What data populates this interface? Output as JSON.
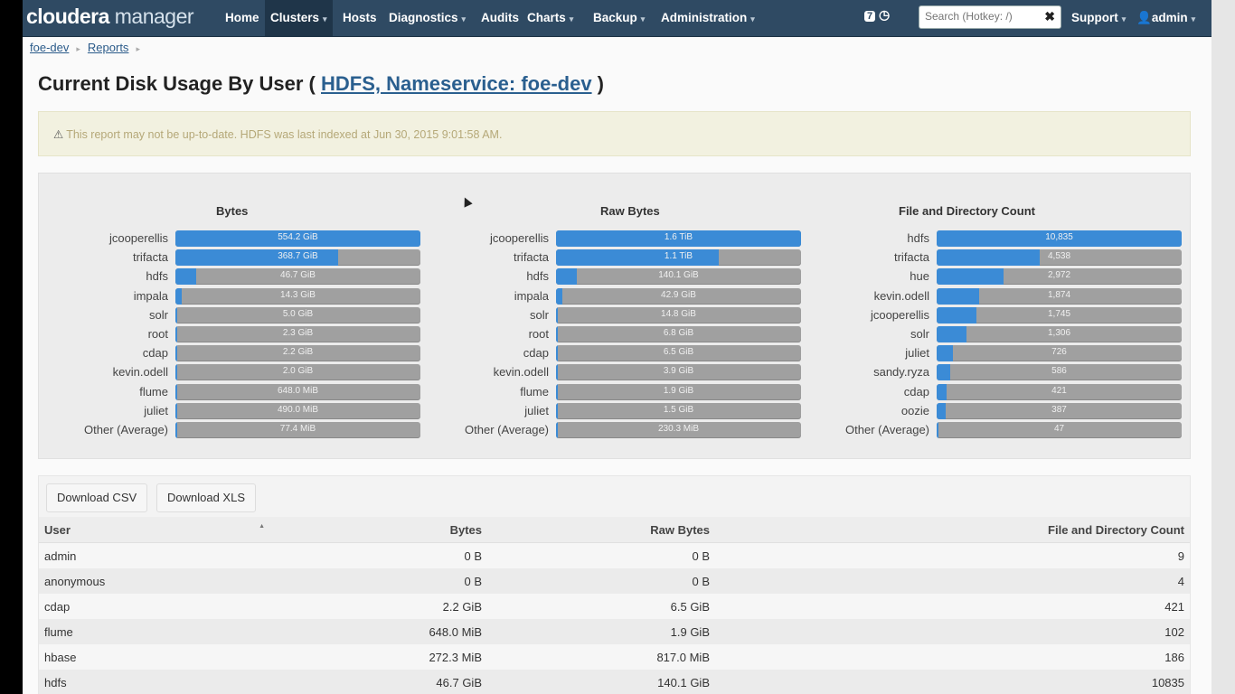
{
  "navbar": {
    "brand_main": "cloudera",
    "brand_sub": "manager",
    "items": [
      {
        "label": "Home",
        "caret": false
      },
      {
        "label": "Clusters",
        "caret": true
      },
      {
        "label": "Hosts",
        "caret": false
      },
      {
        "label": "Diagnostics",
        "caret": true
      },
      {
        "label": "Audits",
        "caret": false
      },
      {
        "label": "Charts",
        "caret": true
      },
      {
        "label": "Backup",
        "caret": true
      },
      {
        "label": "Administration",
        "caret": true
      }
    ],
    "notifications": "7",
    "search_placeholder": "Search (Hotkey: /)",
    "support_label": "Support",
    "user_label": "admin"
  },
  "breadcrumb": [
    "foe-dev",
    "Reports"
  ],
  "page_title": {
    "prefix": "Current Disk Usage By User ( ",
    "link": "HDFS, Nameservice: foe-dev",
    "suffix": " )"
  },
  "alert_text": "This report may not be up-to-date. HDFS was last indexed at Jun 30, 2015 9:01:58 AM.",
  "chart_data": [
    {
      "type": "bar",
      "title": "Bytes",
      "categories": [
        "jcooperellis",
        "trifacta",
        "hdfs",
        "impala",
        "solr",
        "root",
        "cdap",
        "kevin.odell",
        "flume",
        "juliet",
        "Other (Average)"
      ],
      "labels": [
        "554.2 GiB",
        "368.7 GiB",
        "46.7 GiB",
        "14.3 GiB",
        "5.0 GiB",
        "2.3 GiB",
        "2.2 GiB",
        "2.0 GiB",
        "648.0 MiB",
        "490.0 MiB",
        "77.4 MiB"
      ],
      "values": [
        1.0,
        0.665,
        0.084,
        0.026,
        0.009,
        0.004,
        0.004,
        0.004,
        0.001,
        0.001,
        0.0001
      ]
    },
    {
      "type": "bar",
      "title": "Raw Bytes",
      "categories": [
        "jcooperellis",
        "trifacta",
        "hdfs",
        "impala",
        "solr",
        "root",
        "cdap",
        "kevin.odell",
        "flume",
        "juliet",
        "Other (Average)"
      ],
      "labels": [
        "1.6 TiB",
        "1.1 TiB",
        "140.1 GiB",
        "42.9 GiB",
        "14.8 GiB",
        "6.8 GiB",
        "6.5 GiB",
        "3.9 GiB",
        "1.9 GiB",
        "1.5 GiB",
        "230.3 MiB"
      ],
      "values": [
        1.0,
        0.665,
        0.084,
        0.026,
        0.009,
        0.004,
        0.004,
        0.002,
        0.001,
        0.001,
        0.0001
      ]
    },
    {
      "type": "bar",
      "title": "File and Directory Count",
      "categories": [
        "hdfs",
        "trifacta",
        "hue",
        "kevin.odell",
        "jcooperellis",
        "solr",
        "juliet",
        "sandy.ryza",
        "cdap",
        "oozie",
        "Other (Average)"
      ],
      "labels": [
        "10,835",
        "4,538",
        "2,972",
        "1,874",
        "1,745",
        "1,306",
        "726",
        "586",
        "421",
        "387",
        "47"
      ],
      "values": [
        10835,
        4538,
        2972,
        1874,
        1745,
        1306,
        726,
        586,
        421,
        387,
        47
      ]
    }
  ],
  "buttons": {
    "download_csv": "Download CSV",
    "download_xls": "Download XLS"
  },
  "table": {
    "headers": [
      "User",
      "Bytes",
      "Raw Bytes",
      "File and Directory Count"
    ],
    "rows": [
      [
        "admin",
        "0 B",
        "0 B",
        "9"
      ],
      [
        "anonymous",
        "0 B",
        "0 B",
        "4"
      ],
      [
        "cdap",
        "2.2 GiB",
        "6.5 GiB",
        "421"
      ],
      [
        "flume",
        "648.0 MiB",
        "1.9 GiB",
        "102"
      ],
      [
        "hbase",
        "272.3 MiB",
        "817.0 MiB",
        "186"
      ],
      [
        "hdfs",
        "46.7 GiB",
        "140.1 GiB",
        "10835"
      ]
    ]
  }
}
